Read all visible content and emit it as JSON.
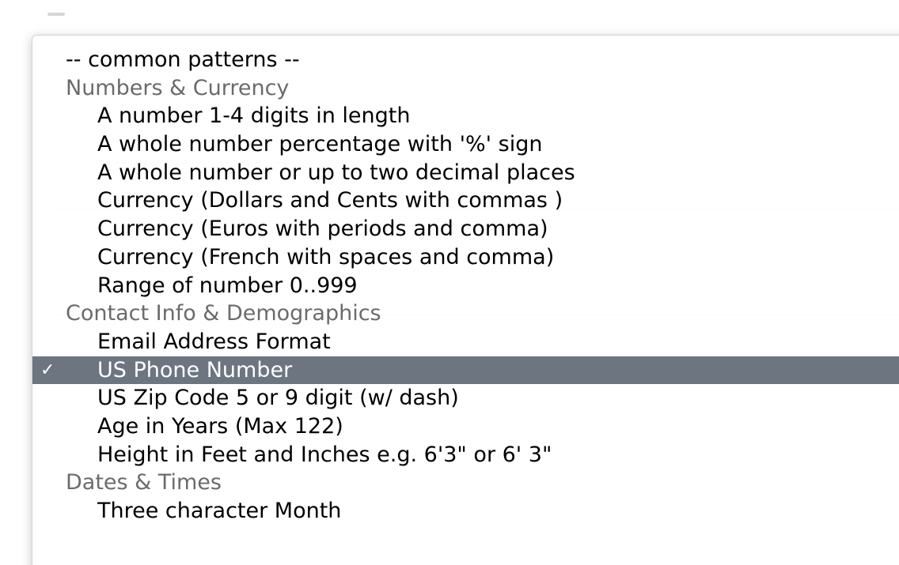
{
  "menu": {
    "items": [
      {
        "kind": "header",
        "label": "-- common patterns --"
      },
      {
        "kind": "group",
        "label": "Numbers & Currency"
      },
      {
        "kind": "item",
        "label": "A number 1-4 digits in length"
      },
      {
        "kind": "item",
        "label": "A whole number percentage with '%' sign"
      },
      {
        "kind": "item",
        "label": "A whole number or up to two decimal places"
      },
      {
        "kind": "item",
        "label": "Currency (Dollars and Cents with commas )"
      },
      {
        "kind": "item",
        "label": "Currency (Euros with periods and comma)"
      },
      {
        "kind": "item",
        "label": "Currency (French with spaces and comma)"
      },
      {
        "kind": "item",
        "label": "Range of number 0..999"
      },
      {
        "kind": "group",
        "label": "Contact Info & Demographics"
      },
      {
        "kind": "item",
        "label": "Email Address Format"
      },
      {
        "kind": "item",
        "label": "US Phone Number",
        "selected": true
      },
      {
        "kind": "item",
        "label": "US Zip Code 5 or 9 digit (w/ dash)"
      },
      {
        "kind": "item",
        "label": "Age in Years (Max 122)"
      },
      {
        "kind": "item",
        "label": "Height in Feet and Inches e.g. 6'3\" or 6' 3\""
      },
      {
        "kind": "group",
        "label": "Dates & Times"
      },
      {
        "kind": "item",
        "label": "Three character Month"
      }
    ],
    "check_glyph": "✓",
    "selected_bg": "#6d7580"
  }
}
